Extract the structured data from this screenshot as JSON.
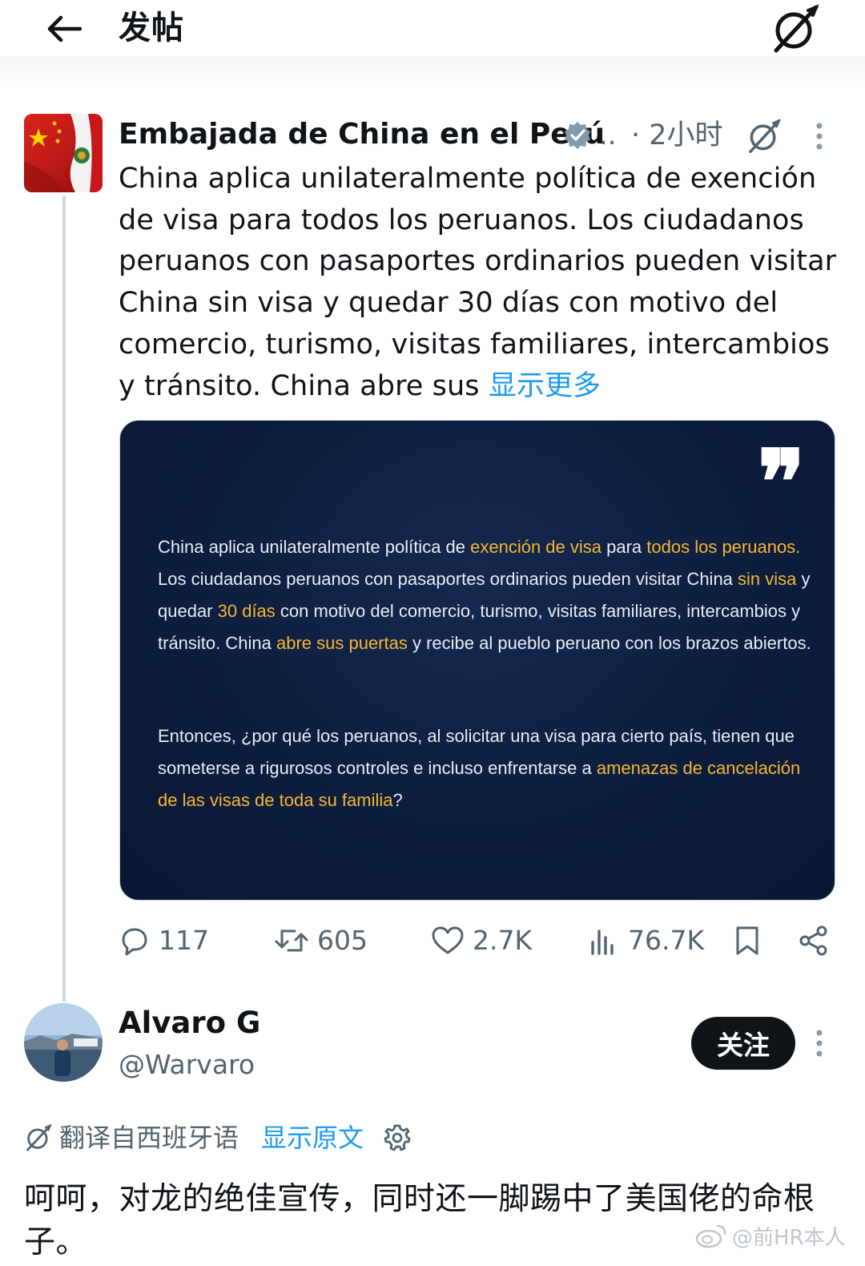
{
  "header": {
    "title": "发帖",
    "back_icon": "arrow-left-icon",
    "grok_icon": "grok-icon"
  },
  "tweet": {
    "author_name": "Embajada de China en el Perú",
    "verified": true,
    "handle_truncated": "..",
    "time": "· 2小时",
    "text": "China aplica unilateralmente política de exención de visa para todos los peruanos. Los ciudadanos peruanos con pasaportes ordinarios pueden visitar China sin visa y quedar 30 días con motivo del comercio, turismo, visitas familiares, intercambios y tránsito. China abre sus ",
    "show_more": "显示更多",
    "media": {
      "quote_mark": "❞",
      "p1": [
        {
          "t": "China aplica unilateralmente política de ",
          "hl": false
        },
        {
          "t": "exención de visa",
          "hl": true
        },
        {
          "t": " para ",
          "hl": false
        },
        {
          "t": "todos los peruanos.",
          "hl": true
        },
        {
          "t": " Los ciudadanos peruanos con pasaportes ordinarios pueden visitar China ",
          "hl": false
        },
        {
          "t": "sin visa",
          "hl": true
        },
        {
          "t": " y quedar ",
          "hl": false
        },
        {
          "t": "30 días",
          "hl": true
        },
        {
          "t": " con motivo del comercio, turismo, visitas familiares, intercambios y tránsito. China ",
          "hl": false
        },
        {
          "t": "abre sus puertas",
          "hl": true
        },
        {
          "t": " y recibe al pueblo peruano con los brazos abiertos.",
          "hl": false
        }
      ],
      "p2": [
        {
          "t": "Entonces, ¿por qué los peruanos, al solicitar una visa para cierto país, tienen que someterse a rigurosos controles e incluso enfrentarse a ",
          "hl": false
        },
        {
          "t": "amenazas de cancelación de las visas de toda su familia",
          "hl": true
        },
        {
          "t": "?",
          "hl": false
        }
      ],
      "text_color": "#e8ecf5",
      "highlight_color": "#f5b731",
      "background": "#0d1d3e"
    },
    "actions": {
      "replies": "117",
      "retweets": "605",
      "likes": "2.7K",
      "views": "76.7K"
    }
  },
  "reply": {
    "name": "Alvaro G",
    "handle": "@Warvaro",
    "follow_label": "关注",
    "translation_label": "翻译自西班牙语",
    "show_original": "显示原文",
    "text": "呵呵，对龙的绝佳宣传，同时还一脚踢中了美国佬的命根子。"
  },
  "watermark": {
    "text": "@前HR本人"
  },
  "colors": {
    "accent": "#1d9bf0",
    "text_primary": "#0f1419",
    "text_secondary": "#536471",
    "thread_line": "#cfd9de"
  }
}
